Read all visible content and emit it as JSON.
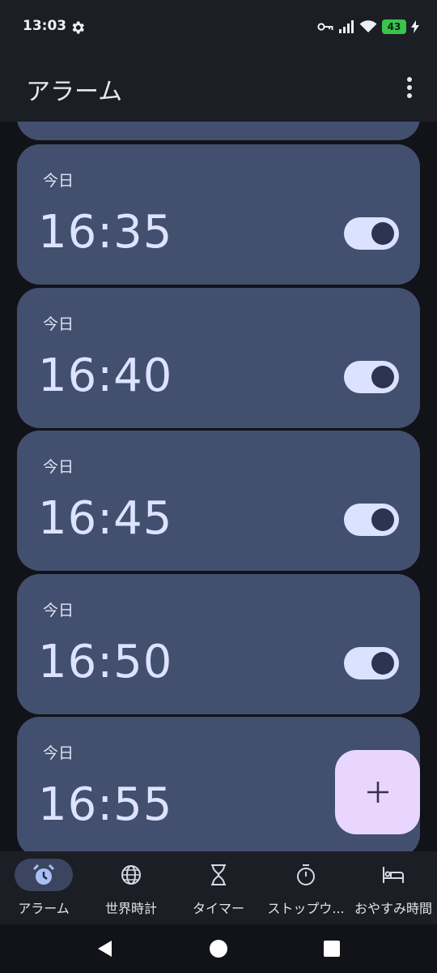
{
  "status": {
    "time": "13:03",
    "battery": "43"
  },
  "app_bar": {
    "title": "アラーム"
  },
  "alarms": [
    {
      "label": "今日",
      "time": "16:35",
      "enabled": true
    },
    {
      "label": "今日",
      "time": "16:40",
      "enabled": true
    },
    {
      "label": "今日",
      "time": "16:45",
      "enabled": true
    },
    {
      "label": "今日",
      "time": "16:50",
      "enabled": true
    },
    {
      "label": "今日",
      "time": "16:55",
      "enabled": true
    }
  ],
  "fab": {
    "icon": "plus-icon"
  },
  "nav": {
    "items": [
      {
        "label": "アラーム",
        "icon": "alarm-clock-icon",
        "active": true
      },
      {
        "label": "世界時計",
        "icon": "globe-icon",
        "active": false
      },
      {
        "label": "タイマー",
        "icon": "hourglass-icon",
        "active": false
      },
      {
        "label": "ストップウ...",
        "icon": "stopwatch-icon",
        "active": false
      },
      {
        "label": "おやすみ時間",
        "icon": "bed-icon",
        "active": false
      }
    ]
  },
  "colors": {
    "card": "#434f6f",
    "toggle_track": "#dae2ff",
    "fab": "#e9d6ff",
    "battery": "#38c44d"
  }
}
